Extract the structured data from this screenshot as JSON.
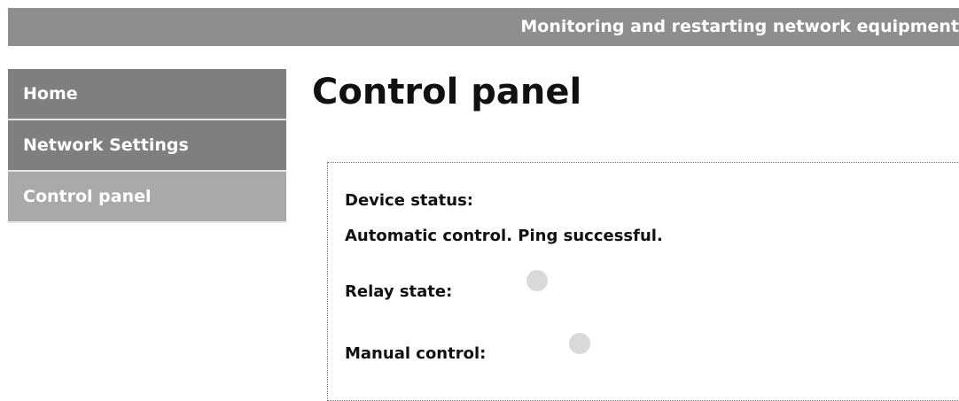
{
  "header": {
    "title": "Monitoring and restarting network equipment"
  },
  "sidebar": {
    "items": [
      {
        "label": "Home"
      },
      {
        "label": "Network Settings"
      },
      {
        "label": "Control panel"
      }
    ]
  },
  "main": {
    "title": "Control panel",
    "device_status_label": "Device status:",
    "device_status_value": "Automatic control. Ping successful.",
    "relay_state_label": "Relay state:",
    "manual_control_label": "Manual control:"
  },
  "colors": {
    "banner": "#8e8e8e",
    "nav_item": "#7f7f7f",
    "nav_item_active": "#a9a9a9",
    "indicator_off": "#d9d9d9"
  }
}
